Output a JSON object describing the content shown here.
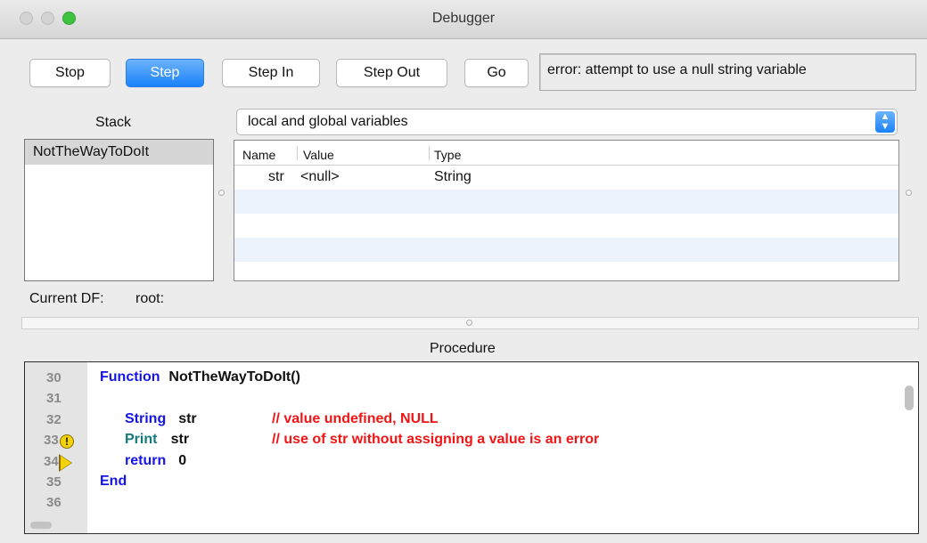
{
  "window": {
    "title": "Debugger"
  },
  "toolbar": {
    "stop_label": "Stop",
    "step_label": "Step",
    "step_in_label": "Step In",
    "step_out_label": "Step Out",
    "go_label": "Go",
    "message": "error: attempt to use a null string variable"
  },
  "stack": {
    "title": "Stack",
    "items": [
      "NotTheWayToDoIt"
    ]
  },
  "variables": {
    "scope_select": "local and global variables",
    "columns": {
      "name": "Name",
      "value": "Value",
      "type": "Type"
    },
    "rows": [
      {
        "name": "str",
        "value": "<null>",
        "type": "String"
      }
    ]
  },
  "current_df": {
    "label": "Current DF:",
    "value": "root:"
  },
  "procedure": {
    "title": "Procedure",
    "lines": [
      {
        "num": "30",
        "segments": [
          {
            "text": "Function ",
            "style": "kw-blue"
          },
          {
            "text": "NotTheWayToDoIt()",
            "style": "plain"
          }
        ]
      },
      {
        "num": "31",
        "segments": []
      },
      {
        "num": "32",
        "segments": [
          {
            "text": "String ",
            "style": "kw-blue"
          },
          {
            "text": "str",
            "style": "plain"
          },
          {
            "text": "// value undefined, NULL",
            "style": "cmt"
          }
        ]
      },
      {
        "num": "33",
        "marker": "warning",
        "segments": [
          {
            "text": "Print ",
            "style": "kw-green"
          },
          {
            "text": "str",
            "style": "plain"
          },
          {
            "text": "// use of str without assigning a value is an error",
            "style": "cmt"
          }
        ]
      },
      {
        "num": "34",
        "marker": "current-line",
        "segments": [
          {
            "text": "return ",
            "style": "kw-blue"
          },
          {
            "text": "0",
            "style": "plain"
          }
        ]
      },
      {
        "num": "35",
        "segments": [
          {
            "text": "End",
            "style": "kw-blue"
          }
        ]
      },
      {
        "num": "36",
        "segments": []
      }
    ]
  },
  "colors": {
    "accent": "#1a82fb",
    "keyword": "#1414e8",
    "builtin": "#137a7a",
    "comment": "#f21414",
    "warning": "#f4d20a",
    "alt_row": "#edf3fd"
  },
  "icons": {
    "warning_marker": "warning-icon",
    "current_line_marker": "program-counter-arrow-icon",
    "select_arrows": "updown-chevron-icon"
  }
}
